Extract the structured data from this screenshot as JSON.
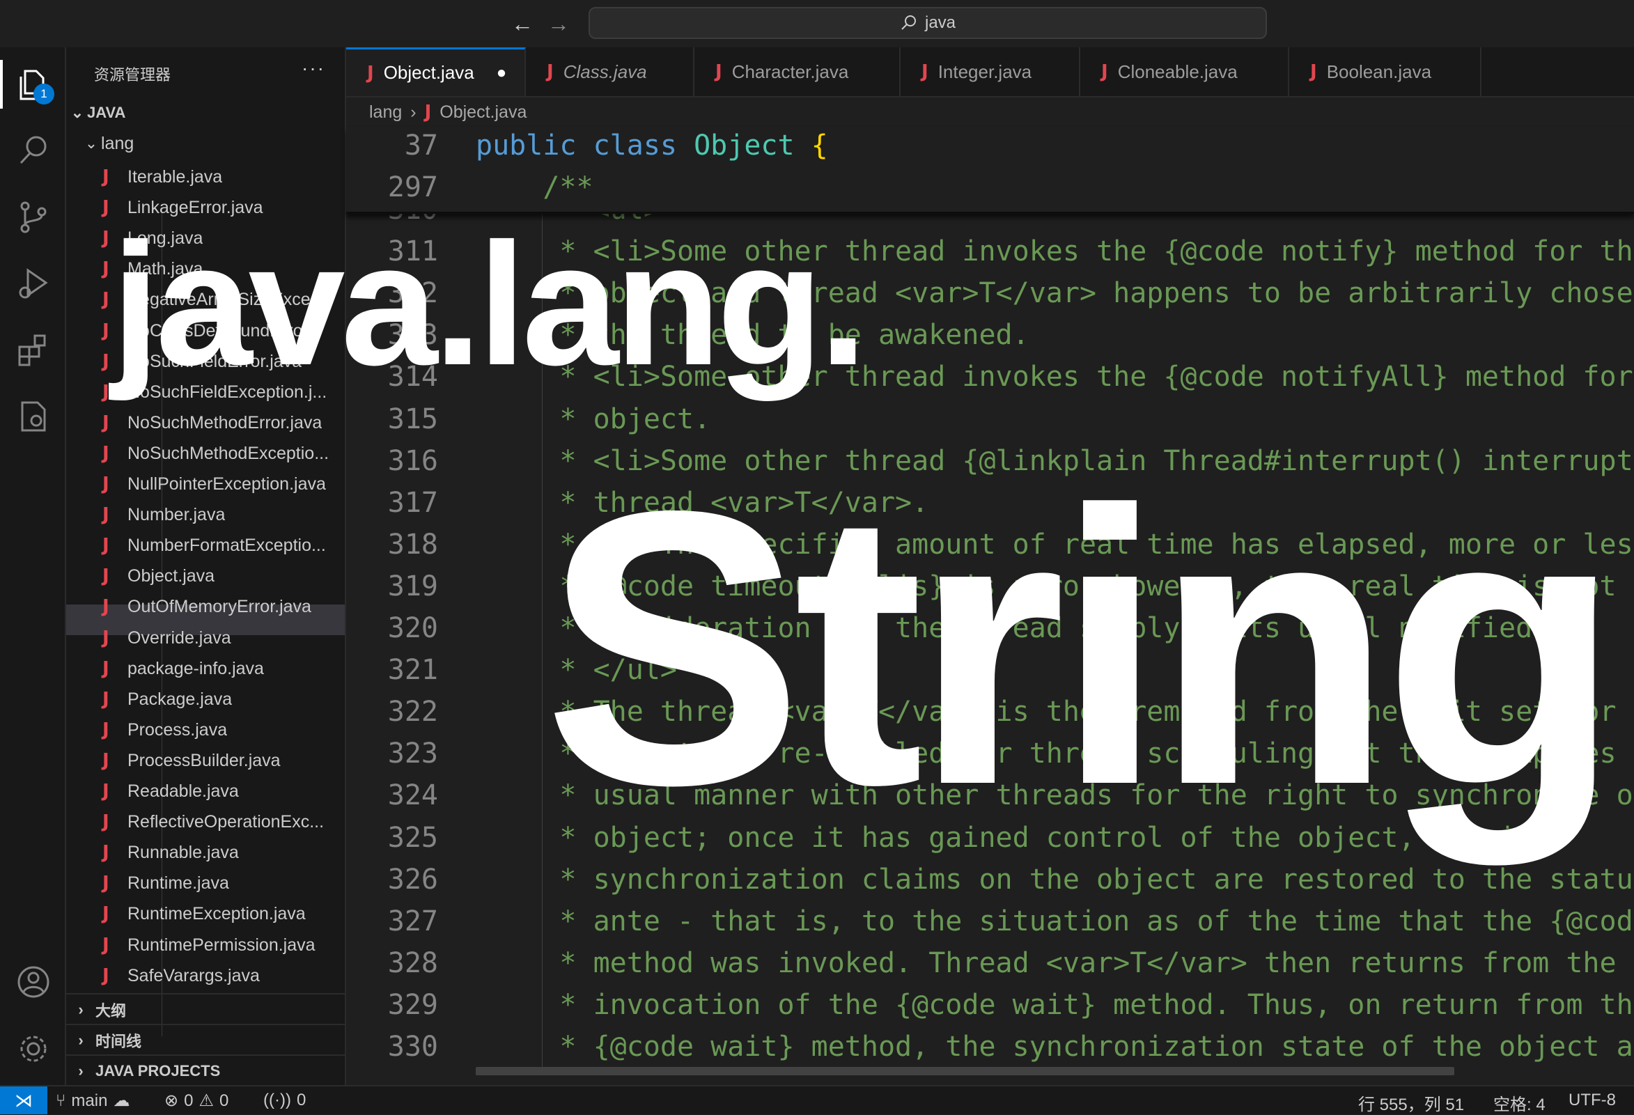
{
  "titlebar": {
    "back_icon": "arrow-left-icon",
    "forward_icon": "arrow-right-icon",
    "search_text": "java"
  },
  "activity": {
    "explorer_badge": "1"
  },
  "sidebar": {
    "title": "资源管理器",
    "more": "···",
    "root": "JAVA",
    "folder": "lang",
    "files": [
      "Iterable.java",
      "LinkageError.java",
      "Long.java",
      "Math.java",
      "NegativeArraySizeExce...",
      "NoClassDefFoundErro...",
      "NoSuchFieldError.java",
      "NoSuchFieldException.j...",
      "NoSuchMethodError.java",
      "NoSuchMethodExceptio...",
      "NullPointerException.java",
      "Number.java",
      "NumberFormatExceptio...",
      "Object.java",
      "OutOfMemoryError.java",
      "Override.java",
      "package-info.java",
      "Package.java",
      "Process.java",
      "ProcessBuilder.java",
      "Readable.java",
      "ReflectiveOperationExc...",
      "Runnable.java",
      "Runtime.java",
      "RuntimeException.java",
      "RuntimePermission.java",
      "SafeVarargs.java"
    ],
    "selected_file": "Object.java",
    "sections": [
      "大纲",
      "时间线",
      "JAVA PROJECTS"
    ]
  },
  "tabs": [
    {
      "label": "Object.java",
      "active": true,
      "dirty": "●"
    },
    {
      "label": "Class.java",
      "italic": true
    },
    {
      "label": "Character.java"
    },
    {
      "label": "Integer.java"
    },
    {
      "label": "Cloneable.java"
    },
    {
      "label": "Boolean.java"
    }
  ],
  "java_glyph": "J",
  "breadcrumb": {
    "folder": "lang",
    "sep": "›",
    "file": "Object.java"
  },
  "sticky": [
    {
      "num": "37",
      "kw": "public class ",
      "cls": "Object",
      "brace": " {"
    },
    {
      "num": "297",
      "text": "    /**"
    }
  ],
  "code": [
    {
      "num": "310",
      "text": "     * <ul>"
    },
    {
      "num": "311",
      "text": "     * <li>Some other thread invokes the {@code notify} method for this"
    },
    {
      "num": "312",
      "text": "     * object and thread <var>T</var> happens to be arbitrarily chosen as"
    },
    {
      "num": "313",
      "text": "     * the thread to be awakened."
    },
    {
      "num": "314",
      "text": "     * <li>Some other thread invokes the {@code notifyAll} method for this"
    },
    {
      "num": "315",
      "text": "     * object."
    },
    {
      "num": "316",
      "text": "     * <li>Some other thread {@linkplain Thread#interrupt() interrupts}"
    },
    {
      "num": "317",
      "text": "     * thread <var>T</var>."
    },
    {
      "num": "318",
      "text": "     * <li>The specified amount of real time has elapsed, more or less."
    },
    {
      "num": "319",
      "text": "     * {@code timeoutMillis} is zero, however, then real time is not taken"
    },
    {
      "num": "320",
      "text": "     * consideration and the thread simply waits until notified."
    },
    {
      "num": "321",
      "text": "     * </ul>"
    },
    {
      "num": "322",
      "text": "     * The thread <var>T</var> is then removed from the wait set for this"
    },
    {
      "num": "323",
      "text": "     * object and re-enabled for thread scheduling. It then competes in the"
    },
    {
      "num": "324",
      "text": "     * usual manner with other threads for the right to synchronize on the"
    },
    {
      "num": "325",
      "text": "     * object; once it has gained control of the object, all its"
    },
    {
      "num": "326",
      "text": "     * synchronization claims on the object are restored to the status quo"
    },
    {
      "num": "327",
      "text": "     * ante - that is, to the situation as of the time that the {@code wait}"
    },
    {
      "num": "328",
      "text": "     * method was invoked. Thread <var>T</var> then returns from the"
    },
    {
      "num": "329",
      "text": "     * invocation of the {@code wait} method. Thus, on return from the"
    },
    {
      "num": "330",
      "text": "     * {@code wait} method, the synchronization state of the object and of"
    }
  ],
  "overlay": {
    "title": "java.lang.",
    "subtitle": "String"
  },
  "status": {
    "branch": "main",
    "errors": "0",
    "warnings": "0",
    "ports": "0",
    "position": "行 555，列 51",
    "spaces": "空格: 4",
    "encoding": "UTF-8"
  },
  "colors": {
    "accent": "#0078d4",
    "java_icon": "#e2464f",
    "comment": "#6a9955",
    "keyword": "#569cd6",
    "class": "#4ec9b0"
  }
}
